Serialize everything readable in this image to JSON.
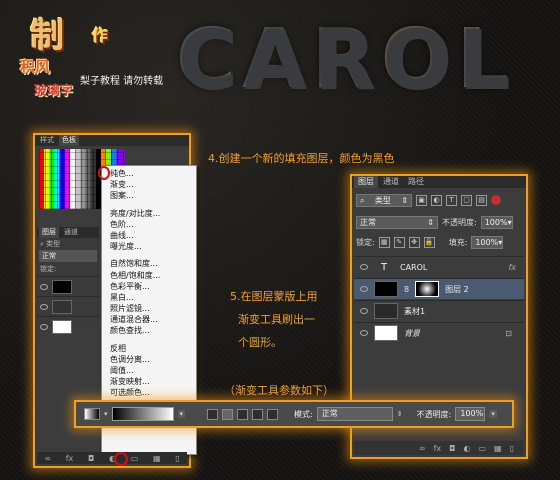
{
  "header": {
    "logo_main": "制",
    "logo_main2": "作",
    "logo_sub1": "积风",
    "logo_sub2": "玻璃字",
    "logo_tag": "梨子教程 请勿转载",
    "title_art": "CAROL"
  },
  "left_panel": {
    "tabs": [
      "样式",
      "色板"
    ],
    "menu_items": [
      "纯色...",
      "渐变...",
      "图案...",
      "",
      "亮度/对比度...",
      "色阶...",
      "曲线...",
      "曝光度...",
      "",
      "自然饱和度...",
      "色相/饱和度...",
      "色彩平衡...",
      "黑白...",
      "照片滤镜...",
      "通道混合器...",
      "颜色查找...",
      "",
      "反相",
      "色调分离...",
      "阈值...",
      "渐变映射...",
      "可选颜色..."
    ],
    "layers_tabs": [
      "图层",
      "通道"
    ],
    "kind_label": "类型",
    "blend_mode": "正常",
    "lock_label": "锁定:",
    "bottom_icons": [
      "∞",
      "fx",
      "◘",
      "◐",
      "▭",
      "▦",
      "▯"
    ]
  },
  "right_panel": {
    "tabs": [
      "图层",
      "通道",
      "路径"
    ],
    "kind_label": "类型",
    "blend_mode": "正常",
    "opacity_label": "不透明度:",
    "opacity_value": "100%",
    "lock_label": "锁定:",
    "fill_label": "填充:",
    "fill_value": "100%",
    "layers": [
      {
        "name": "CAROL",
        "type_icon": "T",
        "fx": "fx"
      },
      {
        "name": "图层 2"
      },
      {
        "name": "素材1"
      },
      {
        "name": "背景",
        "locked": true
      }
    ],
    "bottom_icons": [
      "∞",
      "fx",
      "◘",
      "◐",
      "▭",
      "▦",
      "▯"
    ]
  },
  "notes": {
    "step4": "4.创建一个新的填充图层，颜色为黑色",
    "step5_line1": "5.在图层蒙版上用",
    "step5_line2": "渐变工具刷出一",
    "step5_line3": "个圆形。",
    "params": "（渐变工具参数如下）"
  },
  "gradient_bar": {
    "mode_label": "模式:",
    "mode_value": "正常",
    "opacity_label": "不透明度:",
    "opacity_value": "100%"
  },
  "colors": {
    "highlight": "#f0a020",
    "note_text": "#f2a030",
    "marker_red": "#d01010"
  }
}
